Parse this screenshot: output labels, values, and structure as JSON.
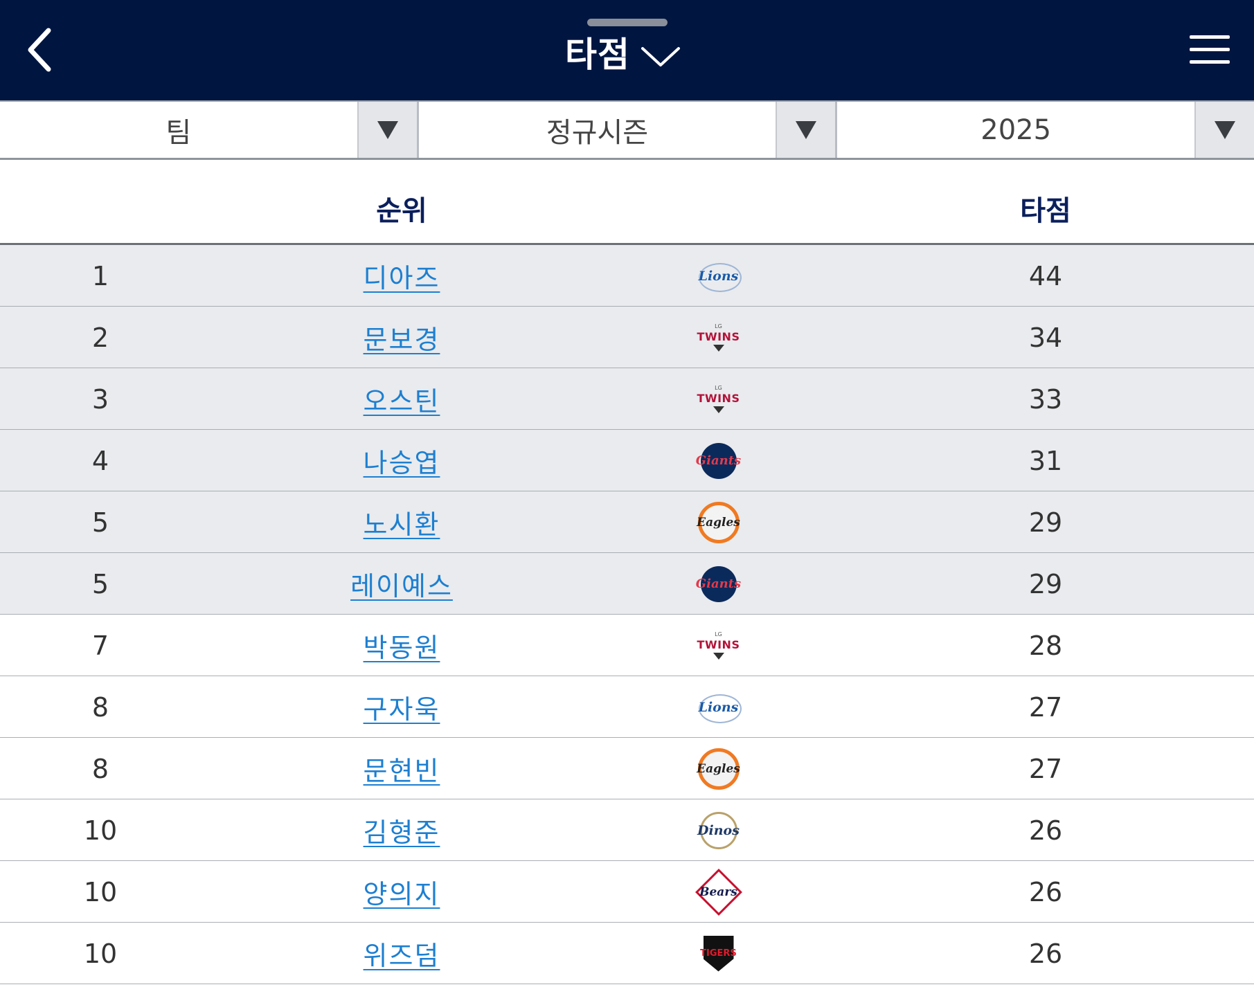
{
  "header": {
    "title": "타점",
    "back_icon": "chevron-left-icon",
    "dropdown_icon": "chevron-down-icon",
    "menu_icon": "hamburger-menu-icon",
    "background": "#001540"
  },
  "filters": [
    {
      "label": "팀"
    },
    {
      "label": "정규시즌"
    },
    {
      "label": "2025"
    }
  ],
  "table": {
    "columns": {
      "rank": "순위",
      "rbi": "타점"
    },
    "highlight_top_rows": 6,
    "rows": [
      {
        "rank": "1",
        "name": "디아즈",
        "team_logo": "Lions",
        "team_icon": "samsung-lions-logo",
        "rbi": "44"
      },
      {
        "rank": "2",
        "name": "문보경",
        "team_logo": "TWINS",
        "team_icon": "lg-twins-logo",
        "rbi": "34"
      },
      {
        "rank": "3",
        "name": "오스틴",
        "team_logo": "TWINS",
        "team_icon": "lg-twins-logo",
        "rbi": "33"
      },
      {
        "rank": "4",
        "name": "나승엽",
        "team_logo": "Giants",
        "team_icon": "lotte-giants-logo",
        "rbi": "31"
      },
      {
        "rank": "5",
        "name": "노시환",
        "team_logo": "Eagles",
        "team_icon": "hanwha-eagles-logo",
        "rbi": "29"
      },
      {
        "rank": "5",
        "name": "레이예스",
        "team_logo": "Giants",
        "team_icon": "lotte-giants-logo",
        "rbi": "29"
      },
      {
        "rank": "7",
        "name": "박동원",
        "team_logo": "TWINS",
        "team_icon": "lg-twins-logo",
        "rbi": "28"
      },
      {
        "rank": "8",
        "name": "구자욱",
        "team_logo": "Lions",
        "team_icon": "samsung-lions-logo",
        "rbi": "27"
      },
      {
        "rank": "8",
        "name": "문현빈",
        "team_logo": "Eagles",
        "team_icon": "hanwha-eagles-logo",
        "rbi": "27"
      },
      {
        "rank": "10",
        "name": "김형준",
        "team_logo": "Dinos",
        "team_icon": "nc-dinos-logo",
        "rbi": "26"
      },
      {
        "rank": "10",
        "name": "양의지",
        "team_logo": "Bears",
        "team_icon": "doosan-bears-logo",
        "rbi": "26"
      },
      {
        "rank": "10",
        "name": "위즈덤",
        "team_logo": "TIGERS",
        "team_icon": "kia-tigers-logo",
        "rbi": "26"
      }
    ]
  }
}
